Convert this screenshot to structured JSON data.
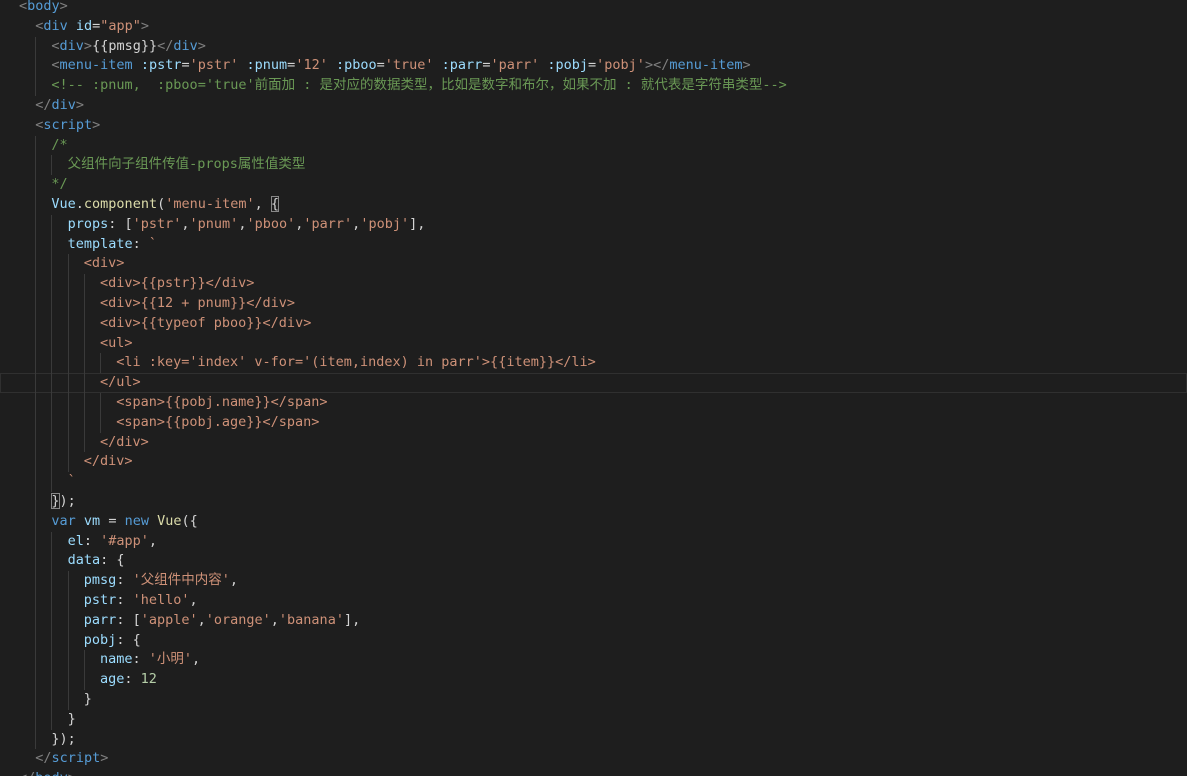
{
  "editor": {
    "language": "html",
    "colors": {
      "background": "#1e1e1e",
      "tag": "#569cd6",
      "tag_bracket": "#808080",
      "attribute": "#9cdcfe",
      "string": "#ce9178",
      "comment": "#6a9955",
      "keyword": "#569cd6",
      "function": "#dcdcaa",
      "variable": "#9cdcfe",
      "number": "#b5cea8",
      "plain": "#d4d4d4"
    },
    "lines": [
      {
        "indent": 0,
        "tokens": [
          [
            "<",
            "br"
          ],
          [
            "body",
            "tag"
          ],
          [
            ">",
            "br"
          ]
        ]
      },
      {
        "indent": 1,
        "tokens": [
          [
            "<",
            "br"
          ],
          [
            "div",
            "tag"
          ],
          [
            " ",
            "pl"
          ],
          [
            "id",
            "attr"
          ],
          [
            "=",
            "pl"
          ],
          [
            "\"app\"",
            "str"
          ],
          [
            ">",
            "br"
          ]
        ]
      },
      {
        "indent": 2,
        "tokens": [
          [
            "<",
            "br"
          ],
          [
            "div",
            "tag"
          ],
          [
            ">",
            "br"
          ],
          [
            "{{pmsg}}",
            "pl"
          ],
          [
            "</",
            "br"
          ],
          [
            "div",
            "tag"
          ],
          [
            ">",
            "br"
          ]
        ]
      },
      {
        "indent": 2,
        "tokens": [
          [
            "<",
            "br"
          ],
          [
            "menu-item",
            "tag"
          ],
          [
            " ",
            "pl"
          ],
          [
            ":pstr",
            "attr"
          ],
          [
            "=",
            "pl"
          ],
          [
            "'pstr'",
            "str"
          ],
          [
            " ",
            "pl"
          ],
          [
            ":pnum",
            "attr"
          ],
          [
            "=",
            "pl"
          ],
          [
            "'12'",
            "str"
          ],
          [
            " ",
            "pl"
          ],
          [
            ":pboo",
            "attr"
          ],
          [
            "=",
            "pl"
          ],
          [
            "'true'",
            "str"
          ],
          [
            " ",
            "pl"
          ],
          [
            ":parr",
            "attr"
          ],
          [
            "=",
            "pl"
          ],
          [
            "'parr'",
            "str"
          ],
          [
            " ",
            "pl"
          ],
          [
            ":pobj",
            "attr"
          ],
          [
            "=",
            "pl"
          ],
          [
            "'pobj'",
            "str"
          ],
          [
            ">",
            "br"
          ],
          [
            "</",
            "br"
          ],
          [
            "menu-item",
            "tag"
          ],
          [
            ">",
            "br"
          ]
        ]
      },
      {
        "indent": 2,
        "tokens": [
          [
            "<!-- :pnum,  :pboo='true'前面加 : 是对应的数据类型，比如是数字和布尔，如果不加 : 就代表是字符串类型-->",
            "cmt"
          ]
        ]
      },
      {
        "indent": 1,
        "tokens": [
          [
            "</",
            "br"
          ],
          [
            "div",
            "tag"
          ],
          [
            ">",
            "br"
          ]
        ]
      },
      {
        "indent": 1,
        "tokens": [
          [
            "<",
            "br"
          ],
          [
            "script",
            "tag"
          ],
          [
            ">",
            "br"
          ]
        ]
      },
      {
        "indent": 2,
        "tokens": [
          [
            "/*",
            "cmt"
          ]
        ]
      },
      {
        "indent": 3,
        "tokens": [
          [
            "父组件向子组件传值-props属性值类型",
            "cmt"
          ]
        ]
      },
      {
        "indent": 2,
        "tokens": [
          [
            "*/",
            "cmt"
          ]
        ]
      },
      {
        "indent": 2,
        "tokens": [
          [
            "Vue",
            "var"
          ],
          [
            ".",
            "pl"
          ],
          [
            "component",
            "fn"
          ],
          [
            "(",
            "pl"
          ],
          [
            "'menu-item'",
            "str"
          ],
          [
            ", ",
            "pl"
          ],
          [
            "{",
            "box"
          ]
        ]
      },
      {
        "indent": 3,
        "tokens": [
          [
            "props",
            "var"
          ],
          [
            ": [",
            "pl"
          ],
          [
            "'pstr'",
            "str"
          ],
          [
            ",",
            "pl"
          ],
          [
            "'pnum'",
            "str"
          ],
          [
            ",",
            "pl"
          ],
          [
            "'pboo'",
            "str"
          ],
          [
            ",",
            "pl"
          ],
          [
            "'parr'",
            "str"
          ],
          [
            ",",
            "pl"
          ],
          [
            "'pobj'",
            "str"
          ],
          [
            "],",
            "pl"
          ]
        ]
      },
      {
        "indent": 3,
        "tokens": [
          [
            "template",
            "var"
          ],
          [
            ": ",
            "pl"
          ],
          [
            "`",
            "str"
          ]
        ]
      },
      {
        "indent": 4,
        "tokens": [
          [
            "<div>",
            "str"
          ]
        ]
      },
      {
        "indent": 5,
        "tokens": [
          [
            "<div>{{pstr}}</div>",
            "str"
          ]
        ]
      },
      {
        "indent": 5,
        "tokens": [
          [
            "<div>{{12 + pnum}}</div>",
            "str"
          ]
        ]
      },
      {
        "indent": 5,
        "tokens": [
          [
            "<div>{{typeof pboo}}</div>",
            "str"
          ]
        ]
      },
      {
        "indent": 5,
        "tokens": [
          [
            "<ul>",
            "str"
          ]
        ]
      },
      {
        "indent": 6,
        "tokens": [
          [
            "<li :key='index' v-for='(item,index) in parr'>{{item}}</li>",
            "str"
          ]
        ]
      },
      {
        "indent": 5,
        "tokens": [
          [
            "</ul>",
            "str"
          ]
        ]
      },
      {
        "indent": 6,
        "tokens": [
          [
            "<span>{{pobj.name}}</span>",
            "str"
          ]
        ]
      },
      {
        "indent": 6,
        "tokens": [
          [
            "<span>{{pobj.age}}</span>",
            "str"
          ]
        ]
      },
      {
        "indent": 5,
        "tokens": [
          [
            "</div>",
            "str"
          ]
        ]
      },
      {
        "indent": 4,
        "tokens": [
          [
            "</div>",
            "str"
          ]
        ]
      },
      {
        "indent": 3,
        "tokens": [
          [
            "`",
            "str"
          ]
        ]
      },
      {
        "indent": 2,
        "tokens": [
          [
            "}",
            "box"
          ],
          [
            ");",
            "pl"
          ]
        ]
      },
      {
        "indent": 2,
        "tokens": [
          [
            "var",
            "kw"
          ],
          [
            " ",
            "pl"
          ],
          [
            "vm",
            "var"
          ],
          [
            " = ",
            "pl"
          ],
          [
            "new",
            "kw"
          ],
          [
            " ",
            "pl"
          ],
          [
            "Vue",
            "fn"
          ],
          [
            "({",
            "pl"
          ]
        ]
      },
      {
        "indent": 3,
        "tokens": [
          [
            "el",
            "var"
          ],
          [
            ": ",
            "pl"
          ],
          [
            "'#app'",
            "str"
          ],
          [
            ",",
            "pl"
          ]
        ]
      },
      {
        "indent": 3,
        "tokens": [
          [
            "data",
            "var"
          ],
          [
            ": {",
            "pl"
          ]
        ]
      },
      {
        "indent": 4,
        "tokens": [
          [
            "pmsg",
            "var"
          ],
          [
            ": ",
            "pl"
          ],
          [
            "'父组件中内容'",
            "str"
          ],
          [
            ",",
            "pl"
          ]
        ]
      },
      {
        "indent": 4,
        "tokens": [
          [
            "pstr",
            "var"
          ],
          [
            ": ",
            "pl"
          ],
          [
            "'hello'",
            "str"
          ],
          [
            ",",
            "pl"
          ]
        ]
      },
      {
        "indent": 4,
        "tokens": [
          [
            "parr",
            "var"
          ],
          [
            ": [",
            "pl"
          ],
          [
            "'apple'",
            "str"
          ],
          [
            ",",
            "pl"
          ],
          [
            "'orange'",
            "str"
          ],
          [
            ",",
            "pl"
          ],
          [
            "'banana'",
            "str"
          ],
          [
            "],",
            "pl"
          ]
        ]
      },
      {
        "indent": 4,
        "tokens": [
          [
            "pobj",
            "var"
          ],
          [
            ": {",
            "pl"
          ]
        ]
      },
      {
        "indent": 5,
        "tokens": [
          [
            "name",
            "var"
          ],
          [
            ": ",
            "pl"
          ],
          [
            "'小明'",
            "str"
          ],
          [
            ",",
            "pl"
          ]
        ]
      },
      {
        "indent": 5,
        "tokens": [
          [
            "age",
            "var"
          ],
          [
            ": ",
            "pl"
          ],
          [
            "12",
            "num"
          ]
        ]
      },
      {
        "indent": 4,
        "tokens": [
          [
            "}",
            "pl"
          ]
        ]
      },
      {
        "indent": 3,
        "tokens": [
          [
            "}",
            "pl"
          ]
        ]
      },
      {
        "indent": 2,
        "tokens": [
          [
            "});",
            "pl"
          ]
        ]
      },
      {
        "indent": 1,
        "tokens": [
          [
            "</",
            "br"
          ],
          [
            "script",
            "tag"
          ],
          [
            ">",
            "br"
          ]
        ]
      },
      {
        "indent": 0,
        "tokens": [
          [
            "</",
            "br"
          ],
          [
            "body",
            "tag"
          ],
          [
            ">",
            "br"
          ]
        ]
      }
    ]
  }
}
